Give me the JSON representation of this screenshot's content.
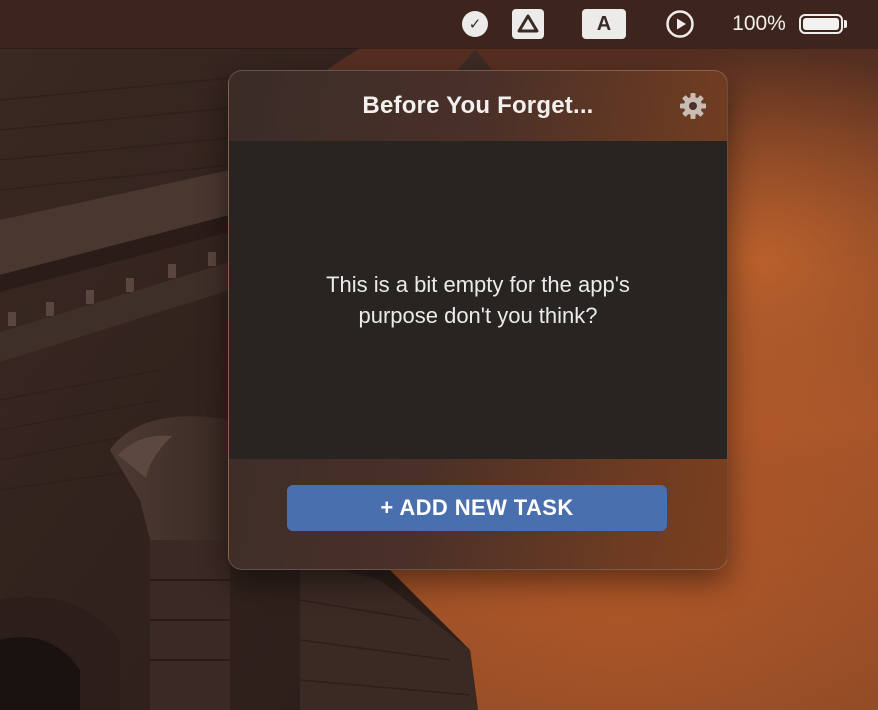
{
  "menubar": {
    "items": [
      {
        "icon": "checkmark-circle-icon",
        "glyph": "✓"
      },
      {
        "icon": "google-drive-icon"
      },
      {
        "icon": "input-source-icon",
        "label": "A"
      },
      {
        "icon": "play-circle-icon"
      }
    ],
    "battery_percent": "100%",
    "battery_level": 1.0
  },
  "popover": {
    "title": "Before You Forget...",
    "settings_icon": "gear-icon",
    "empty_message": "This is a bit empty for the app's purpose don't you think?",
    "add_button_label": "+ ADD NEW TASK"
  },
  "colors": {
    "accent_button": "#4a6fae",
    "body_background": "#272422",
    "menubar_background": "#3c241c"
  }
}
